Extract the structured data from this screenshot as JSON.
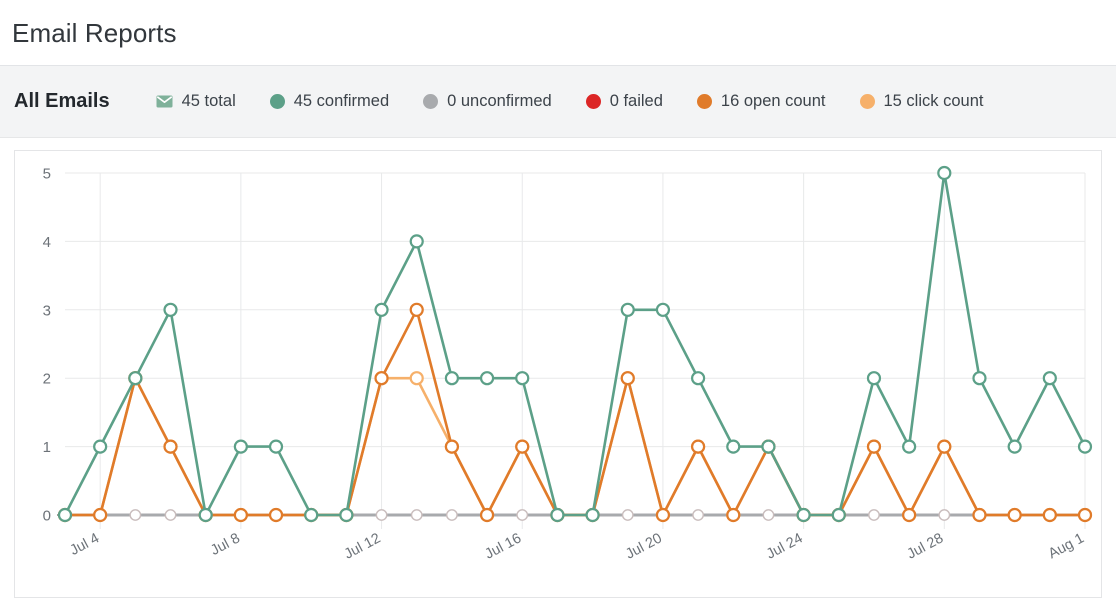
{
  "header": {
    "title": "Email Reports"
  },
  "card": {
    "title": "All Emails",
    "legend": [
      {
        "icon": "envelope-icon",
        "label": "45 total",
        "color": "#7fb19a",
        "shape": "envelope"
      },
      {
        "icon": "dot-icon",
        "label": "45 confirmed",
        "color": "#5ca088",
        "shape": "dot"
      },
      {
        "icon": "dot-icon",
        "label": "0 unconfirmed",
        "color": "#a8aaad",
        "shape": "dot"
      },
      {
        "icon": "dot-icon",
        "label": "0 failed",
        "color": "#dc2626",
        "shape": "dot"
      },
      {
        "icon": "dot-icon",
        "label": "16 open count",
        "color": "#e07b2a",
        "shape": "dot"
      },
      {
        "icon": "dot-icon",
        "label": "15 click count",
        "color": "#f6b06a",
        "shape": "dot"
      }
    ]
  },
  "chart_data": {
    "type": "line",
    "title": "All Emails",
    "xlabel": "",
    "ylabel": "",
    "ylim": [
      0,
      5
    ],
    "yticks": [
      0,
      1,
      2,
      3,
      4,
      5
    ],
    "grid": true,
    "legend_position": "top",
    "x": [
      "Jul 3",
      "Jul 4",
      "Jul 5",
      "Jul 6",
      "Jul 7",
      "Jul 8",
      "Jul 9",
      "Jul 10",
      "Jul 11",
      "Jul 12",
      "Jul 13",
      "Jul 14",
      "Jul 15",
      "Jul 16",
      "Jul 17",
      "Jul 18",
      "Jul 19",
      "Jul 20",
      "Jul 21",
      "Jul 22",
      "Jul 23",
      "Jul 24",
      "Jul 25",
      "Jul 26",
      "Jul 27",
      "Jul 28",
      "Jul 29",
      "Jul 30",
      "Jul 31",
      "Aug 1"
    ],
    "xtick_labels": [
      "Jul 4",
      "Jul 8",
      "Jul 12",
      "Jul 16",
      "Jul 20",
      "Jul 24",
      "Jul 28",
      "Aug 1"
    ],
    "xtick_indices": [
      1,
      5,
      9,
      13,
      17,
      21,
      25,
      29
    ],
    "series": [
      {
        "name": "confirmed",
        "color": "#5ca088",
        "values": [
          0,
          1,
          2,
          3,
          0,
          1,
          1,
          0,
          0,
          3,
          4,
          2,
          2,
          2,
          0,
          0,
          3,
          3,
          2,
          1,
          1,
          0,
          0,
          2,
          1,
          5,
          2,
          1,
          2,
          1
        ]
      },
      {
        "name": "unconfirmed",
        "color": "#a8aaad",
        "values": [
          0,
          0,
          0,
          0,
          0,
          0,
          0,
          0,
          0,
          0,
          0,
          0,
          0,
          0,
          0,
          0,
          0,
          0,
          0,
          0,
          0,
          0,
          0,
          0,
          0,
          0,
          0,
          0,
          0,
          0
        ]
      },
      {
        "name": "failed",
        "color": "#dc2626",
        "values": [
          0,
          0,
          0,
          0,
          0,
          0,
          0,
          0,
          0,
          0,
          0,
          0,
          0,
          0,
          0,
          0,
          0,
          0,
          0,
          0,
          0,
          0,
          0,
          0,
          0,
          0,
          0,
          0,
          0,
          0
        ]
      },
      {
        "name": "open count",
        "color": "#e07b2a",
        "values": [
          0,
          0,
          2,
          1,
          0,
          0,
          0,
          0,
          0,
          2,
          3,
          1,
          0,
          1,
          0,
          0,
          2,
          0,
          1,
          0,
          1,
          0,
          0,
          1,
          0,
          1,
          0,
          0,
          0,
          0
        ]
      },
      {
        "name": "click count",
        "color": "#f6b06a",
        "values": [
          0,
          0,
          2,
          1,
          0,
          0,
          0,
          0,
          0,
          2,
          2,
          1,
          0,
          1,
          0,
          0,
          2,
          0,
          1,
          0,
          1,
          0,
          0,
          1,
          0,
          1,
          0,
          0,
          0,
          0
        ]
      }
    ]
  },
  "colors": {
    "page_bg": "#ffffff",
    "card_head_bg": "#f3f4f5",
    "text": "#32373c",
    "grid": "#e8e9ea",
    "axis_text": "#6c7278"
  }
}
